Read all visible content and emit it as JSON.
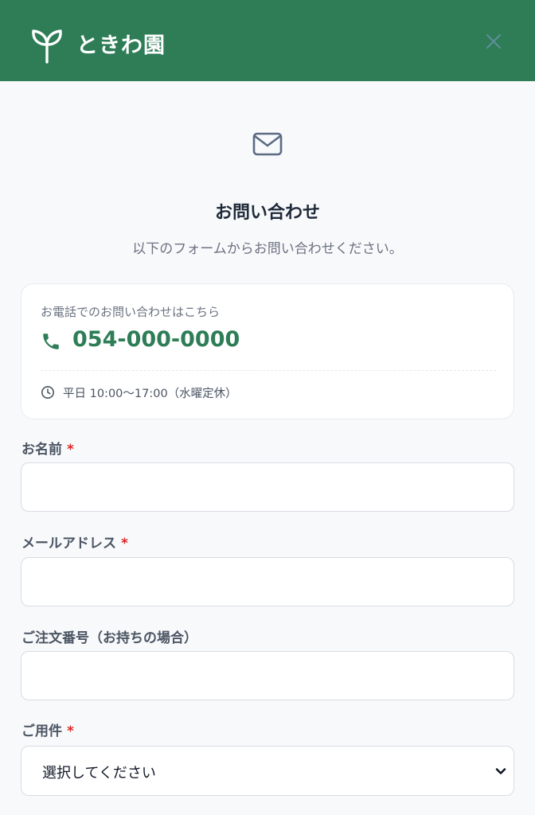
{
  "header": {
    "brand": "ときわ園",
    "logo_icon": "leaf-sprout-icon",
    "close_icon": "close-icon",
    "background_color": "#2e7d57"
  },
  "intro": {
    "icon": "mail-icon",
    "title": "お問い合わせ",
    "subtitle": "以下のフォームからお問い合わせください。"
  },
  "phone_card": {
    "label": "お電話でのお問い合わせはこちら",
    "icon": "phone-icon",
    "number": "054-000-0000",
    "hours_icon": "clock-icon",
    "hours": "平日 10:00〜17:00（水曜定休）"
  },
  "form": {
    "required_mark": "*",
    "name": {
      "label": "お名前",
      "required": true,
      "value": "",
      "placeholder": ""
    },
    "email": {
      "label": "メールアドレス",
      "required": true,
      "value": "",
      "placeholder": ""
    },
    "order_number": {
      "label": "ご注文番号（お持ちの場合）",
      "required": false,
      "value": "",
      "placeholder": ""
    },
    "inquiry_type": {
      "label": "ご用件",
      "required": true,
      "selected": "選択してください"
    }
  },
  "colors": {
    "accent": "#2e7d57",
    "required": "#dc2626",
    "background": "#f8f9fb"
  }
}
